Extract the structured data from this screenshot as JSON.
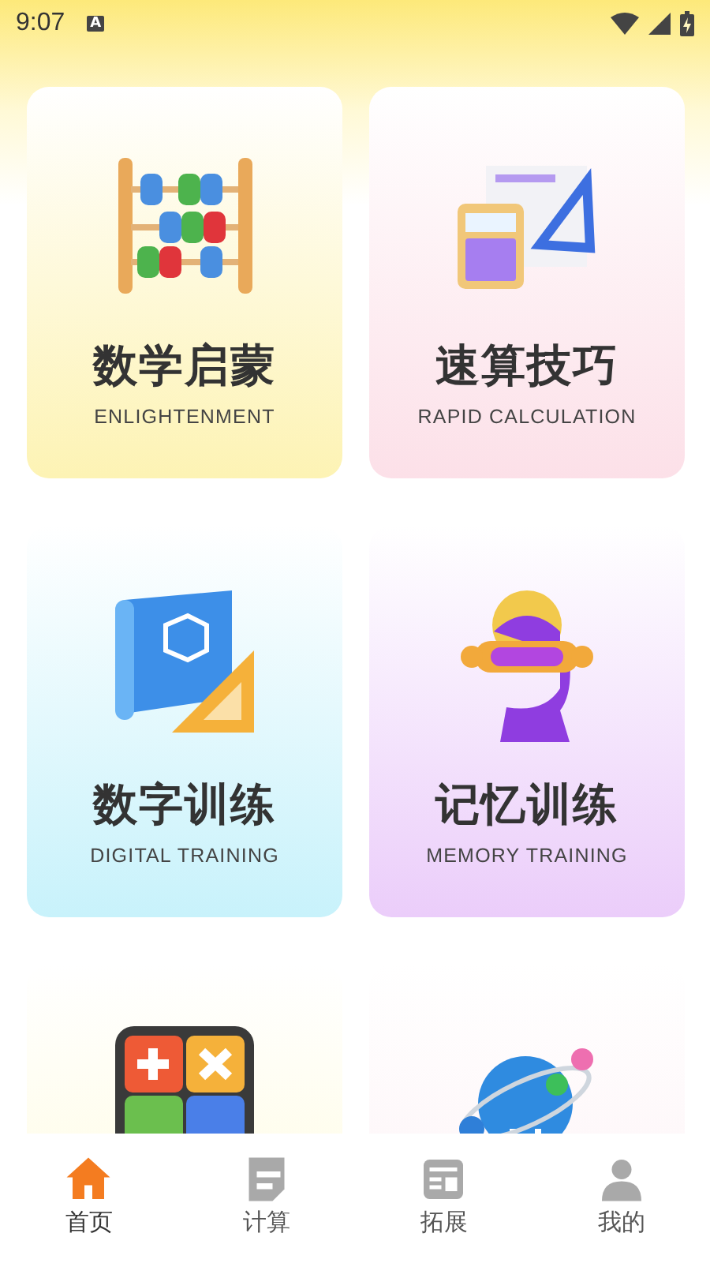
{
  "status_bar": {
    "time": "9:07",
    "notification": "A"
  },
  "cards": [
    {
      "kind": "abacus",
      "title": "数学启蒙",
      "subtitle": "ENLIGHTENMENT"
    },
    {
      "kind": "calculator",
      "title": "速算技巧",
      "subtitle": "RAPID CALCULATION"
    },
    {
      "kind": "blueprint",
      "title": "数字训练",
      "subtitle": "DIGITAL TRAINING"
    },
    {
      "kind": "head",
      "title": "记忆训练",
      "subtitle": "MEMORY TRAINING"
    },
    {
      "kind": "keypad"
    },
    {
      "kind": "bulb"
    }
  ],
  "nav": [
    {
      "kind": "home",
      "label": "首页",
      "selected": true
    },
    {
      "kind": "note",
      "label": "计算",
      "selected": false
    },
    {
      "kind": "news",
      "label": "拓展",
      "selected": false
    },
    {
      "kind": "person",
      "label": "我的",
      "selected": false
    }
  ]
}
